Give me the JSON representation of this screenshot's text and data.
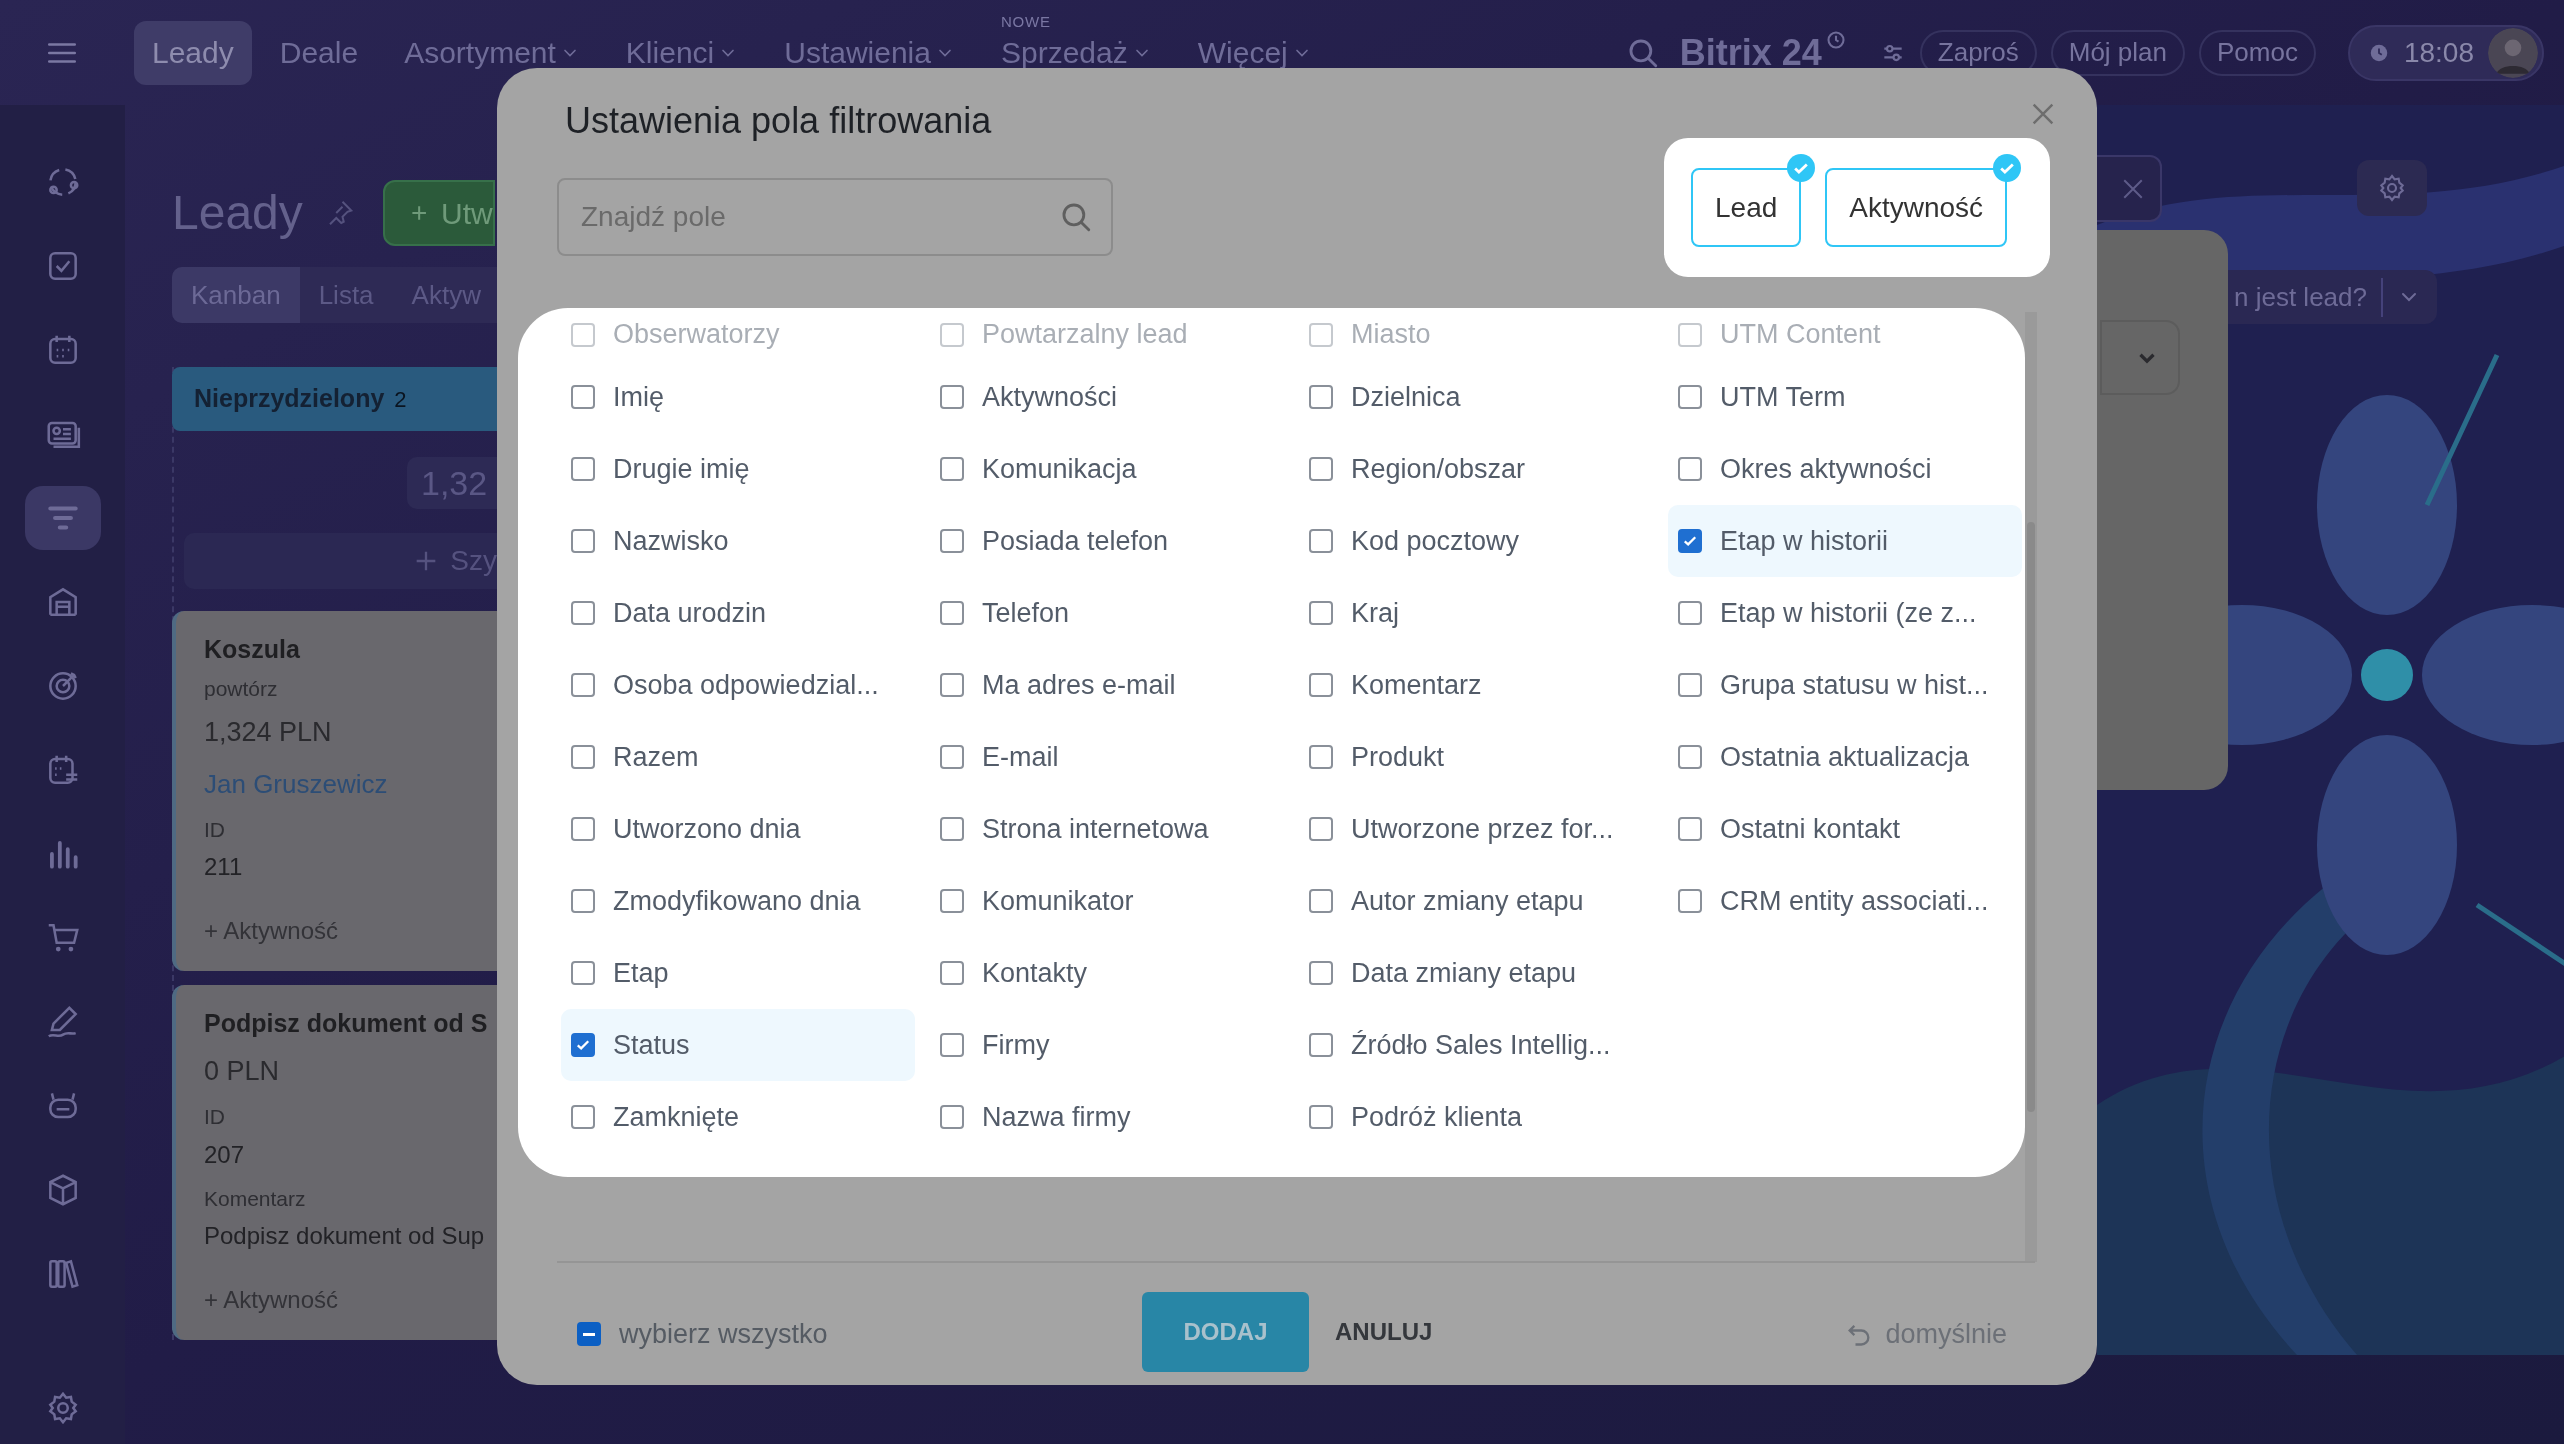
{
  "top_nav": {
    "menu_items": [
      {
        "label": "Leady",
        "selected": true,
        "dropdown": false
      },
      {
        "label": "Deale",
        "selected": false,
        "dropdown": false
      },
      {
        "label": "Asortyment",
        "selected": false,
        "dropdown": true
      },
      {
        "label": "Klienci",
        "selected": false,
        "dropdown": true
      },
      {
        "label": "Ustawienia",
        "selected": false,
        "dropdown": true
      },
      {
        "label": "Sprzedaż",
        "selected": false,
        "dropdown": true,
        "badge": "NOWE"
      },
      {
        "label": "Więcej",
        "selected": false,
        "dropdown": true
      }
    ],
    "brand": "Bitrix 24",
    "buttons": [
      "Zaproś",
      "Mój plan",
      "Pomoc"
    ],
    "clock": "18:08"
  },
  "sidebar": {
    "items": [
      {
        "kind": "cycle",
        "selected": false
      },
      {
        "kind": "task",
        "selected": false
      },
      {
        "kind": "calendar",
        "selected": false
      },
      {
        "kind": "card",
        "selected": false
      },
      {
        "kind": "funnel",
        "selected": true
      },
      {
        "kind": "store",
        "selected": false
      },
      {
        "kind": "target",
        "selected": false
      },
      {
        "kind": "schedule",
        "selected": false
      },
      {
        "kind": "chart",
        "selected": false
      },
      {
        "kind": "cart",
        "selected": false
      },
      {
        "kind": "pen",
        "selected": false
      },
      {
        "kind": "robot",
        "selected": false
      },
      {
        "kind": "box",
        "selected": false
      },
      {
        "kind": "books",
        "selected": false
      },
      {
        "kind": "settings",
        "selected": false
      }
    ]
  },
  "page": {
    "title": "Leady",
    "create_button": "Utw",
    "view_tabs": [
      {
        "label": "Kanban",
        "selected": true
      },
      {
        "label": "Lista",
        "selected": false
      },
      {
        "label": "Aktyw",
        "selected": false
      }
    ],
    "kanban_column": {
      "title": "Nieprzydzielony",
      "count": "2",
      "sum": "1,32",
      "add_button": "Szy",
      "cards": [
        {
          "title": "Koszula",
          "subtitle": "powtórz",
          "amount": "1,324 PLN",
          "contact": "Jan Gruszewicz",
          "fields": [
            {
              "label": "ID",
              "value": "211"
            }
          ],
          "activity": "+ Aktywność"
        },
        {
          "title": "Podpisz dokument od S",
          "amount": "0 PLN",
          "fields": [
            {
              "label": "ID",
              "value": "207"
            },
            {
              "label": "Komentarz",
              "value": "Podpisz dokument od Sup"
            }
          ],
          "activity": "+ Aktywność"
        }
      ]
    },
    "help_dropdown": "n jest lead?"
  },
  "dialog": {
    "title": "Ustawienia pola filtrowania",
    "search": {
      "placeholder": "Znajdź pole"
    },
    "entity_tabs": [
      {
        "label": "Lead",
        "selected": true
      },
      {
        "label": "Aktywność",
        "selected": true
      }
    ],
    "fields": [
      {
        "label": "Obserwatorzy",
        "checked": false,
        "faded": true
      },
      {
        "label": "Imię",
        "checked": false
      },
      {
        "label": "Drugie imię",
        "checked": false
      },
      {
        "label": "Nazwisko",
        "checked": false
      },
      {
        "label": "Data urodzin",
        "checked": false
      },
      {
        "label": "Osoba odpowiedzial...",
        "checked": false
      },
      {
        "label": "Razem",
        "checked": false
      },
      {
        "label": "Utworzono dnia",
        "checked": false
      },
      {
        "label": "Zmodyfikowano dnia",
        "checked": false
      },
      {
        "label": "Etap",
        "checked": false
      },
      {
        "label": "Status",
        "checked": true
      },
      {
        "label": "Zamknięte",
        "checked": false
      },
      {
        "label": "Powtarzalny lead",
        "checked": false,
        "faded": true
      },
      {
        "label": "Aktywności",
        "checked": false
      },
      {
        "label": "Komunikacja",
        "checked": false
      },
      {
        "label": "Posiada telefon",
        "checked": false
      },
      {
        "label": "Telefon",
        "checked": false
      },
      {
        "label": "Ma adres e-mail",
        "checked": false
      },
      {
        "label": "E-mail",
        "checked": false
      },
      {
        "label": "Strona internetowa",
        "checked": false
      },
      {
        "label": "Komunikator",
        "checked": false
      },
      {
        "label": "Kontakty",
        "checked": false
      },
      {
        "label": "Firmy",
        "checked": false
      },
      {
        "label": "Nazwa firmy",
        "checked": false
      },
      {
        "label": "Miasto",
        "checked": false,
        "faded": true
      },
      {
        "label": "Dzielnica",
        "checked": false
      },
      {
        "label": "Region/obszar",
        "checked": false
      },
      {
        "label": "Kod pocztowy",
        "checked": false
      },
      {
        "label": "Kraj",
        "checked": false
      },
      {
        "label": "Komentarz",
        "checked": false
      },
      {
        "label": "Produkt",
        "checked": false
      },
      {
        "label": "Utworzone przez for...",
        "checked": false
      },
      {
        "label": "Autor zmiany etapu",
        "checked": false
      },
      {
        "label": "Data zmiany etapu",
        "checked": false
      },
      {
        "label": "Źródło Sales Intellig...",
        "checked": false
      },
      {
        "label": "Podróż klienta",
        "checked": false
      },
      {
        "label": "UTM Content",
        "checked": false,
        "faded": true
      },
      {
        "label": "UTM Term",
        "checked": false
      },
      {
        "label": "Okres aktywności",
        "checked": false
      },
      {
        "label": "Etap w historii",
        "checked": true
      },
      {
        "label": "Etap w historii (ze z...",
        "checked": false
      },
      {
        "label": "Grupa statusu w hist...",
        "checked": false
      },
      {
        "label": "Ostatnia aktualizacja",
        "checked": false
      },
      {
        "label": "Ostatni kontakt",
        "checked": false
      },
      {
        "label": "CRM entity associati...",
        "checked": false
      }
    ],
    "select_all": {
      "label": "wybierz wszystko",
      "indeterminate": true
    },
    "add_button": "DODAJ",
    "cancel_button": "ANULUJ",
    "reset_button": "domyślnie"
  }
}
